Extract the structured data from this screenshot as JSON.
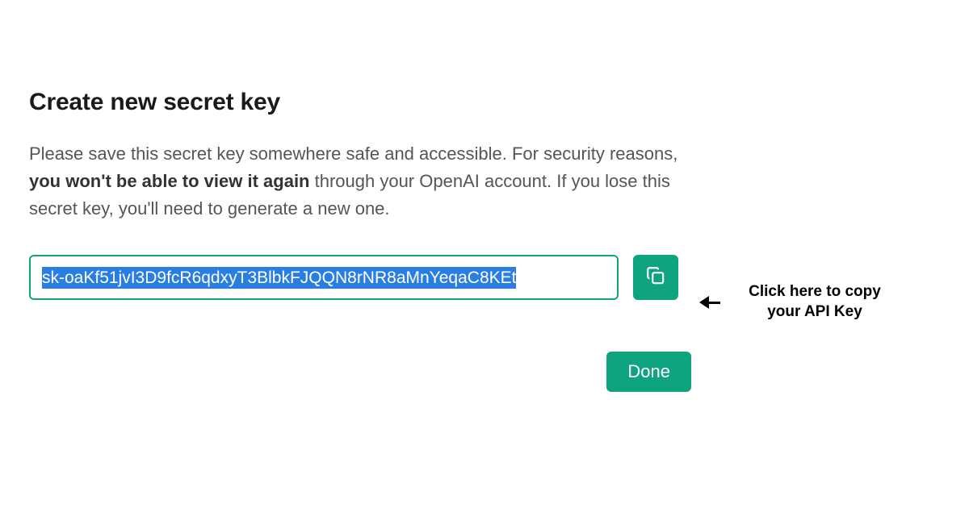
{
  "dialog": {
    "title": "Create new secret key",
    "description_pre": "Please save this secret key somewhere safe and accessible. For security reasons, ",
    "description_emph": "you won't be able to view it again",
    "description_post": " through your OpenAI account. If you lose this secret key, you'll need to generate a new one.",
    "secret_key_value": "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",
    "done_label": "Done"
  },
  "annotation": {
    "text": "Click here to copy your API Key"
  },
  "colors": {
    "accent": "#10A37F",
    "selection": "#2a7de1"
  }
}
